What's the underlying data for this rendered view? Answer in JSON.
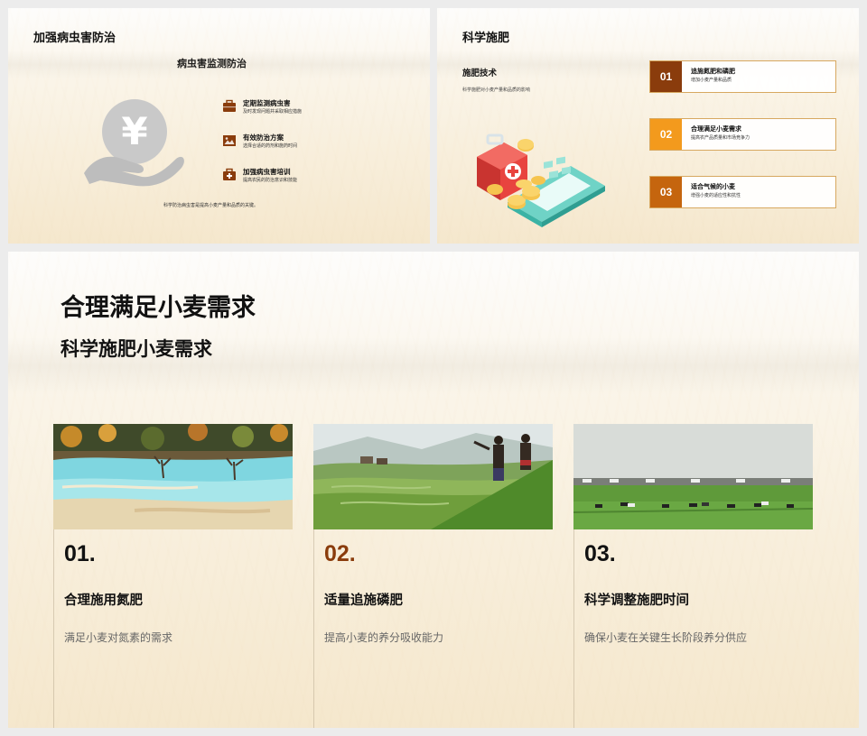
{
  "slide1": {
    "title": "加强病虫害防治",
    "subtitle": "病虫害监测防治",
    "items": [
      {
        "icon": "briefcase-icon",
        "title": "定期监测病虫害",
        "desc": "及时发现问题并采取相应措施"
      },
      {
        "icon": "image-icon",
        "title": "有效防治方案",
        "desc": "选择合适的药剂和施药时间"
      },
      {
        "icon": "medical-kit-icon",
        "title": "加强病虫害培训",
        "desc": "提高农民的防治意识和技能"
      }
    ],
    "note": "科学防治病虫害是提高小麦产量和品质的关键。",
    "illustration": {
      "icon": "hand-money-icon",
      "symbol": "¥"
    },
    "colors": {
      "icon": "#8a3c0c",
      "illustration": "#c8c8c8"
    }
  },
  "slide2": {
    "title": "科学施肥",
    "section_title": "施肥技术",
    "section_desc": "科学施肥对小麦产量和品质的影响",
    "illustration": "calculator-coins-medical-icon",
    "cards": [
      {
        "num": "01",
        "title": "追施氮肥和磷肥",
        "desc": "增加小麦产量和品质",
        "color": "#8a3c0c"
      },
      {
        "num": "02",
        "title": "合理满足小麦需求",
        "desc": "提高农产品质量和市场竞争力",
        "color": "#f39a1d"
      },
      {
        "num": "03",
        "title": "适合气候的小麦",
        "desc": "增强小麦的适应性和抗性",
        "color": "#c5650e"
      }
    ]
  },
  "slide3": {
    "title": "合理满足小麦需求",
    "subtitle": "科学施肥小麦需求",
    "columns": [
      {
        "num": "01.",
        "title": "合理施用氮肥",
        "desc": "满足小麦对氮素的需求",
        "num_color": "#111111",
        "photo": "turquoise-pools-photo"
      },
      {
        "num": "02.",
        "title": "适量追施磷肥",
        "desc": "提高小麦的养分吸收能力",
        "num_color": "#8a3c0c",
        "photo": "rice-terrace-farmers-photo"
      },
      {
        "num": "03.",
        "title": "科学调整施肥时间",
        "desc": "确保小麦在关键生长阶段养分供应",
        "num_color": "#111111",
        "photo": "grazing-cattle-field-photo"
      }
    ]
  }
}
